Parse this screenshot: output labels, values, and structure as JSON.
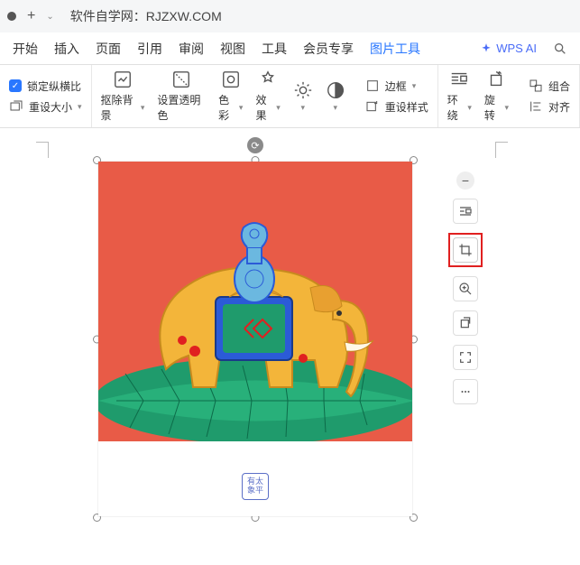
{
  "titlebar": {
    "title": "软件自学网：RJZXW.COM"
  },
  "menu": {
    "items": [
      "开始",
      "插入",
      "页面",
      "引用",
      "审阅",
      "视图",
      "工具",
      "会员专享",
      "图片工具"
    ],
    "active_index": 8,
    "wps_ai": "WPS AI"
  },
  "toolbar": {
    "lock_ratio": "锁定纵横比",
    "reset_size": "重设大小",
    "remove_bg": "抠除背景",
    "set_transparent": "设置透明色",
    "color": "色彩",
    "effect": "效果",
    "border": "边框",
    "reset_style": "重设样式",
    "wrap": "环绕",
    "rotate": "旋转",
    "group": "组合",
    "align": "对齐"
  },
  "caption": "有太\n象平",
  "side_tools": {
    "crop_highlighted": true
  }
}
